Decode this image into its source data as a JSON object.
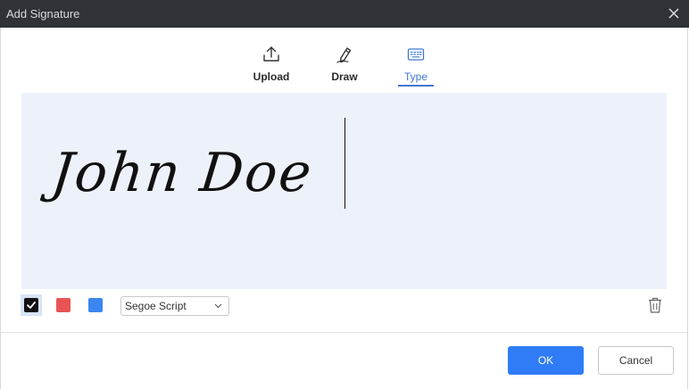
{
  "window": {
    "title": "Add Signature",
    "close_icon": "close-icon"
  },
  "tabs": [
    {
      "label": "Upload",
      "icon": "upload-icon",
      "active": false
    },
    {
      "label": "Draw",
      "icon": "pen-icon",
      "active": false
    },
    {
      "label": "Type",
      "icon": "keyboard-icon",
      "active": true
    }
  ],
  "signature": {
    "text": "John Doe"
  },
  "colors": {
    "swatches": [
      {
        "name": "black",
        "hex": "#111111",
        "selected": true
      },
      {
        "name": "red",
        "hex": "#e85454",
        "selected": false
      },
      {
        "name": "blue",
        "hex": "#3b86f0",
        "selected": false
      }
    ],
    "accent": "#3f78d4",
    "ok_button": "#2f7cf6"
  },
  "font_select": {
    "value": "Segoe Script"
  },
  "footer": {
    "ok_label": "OK",
    "cancel_label": "Cancel"
  }
}
